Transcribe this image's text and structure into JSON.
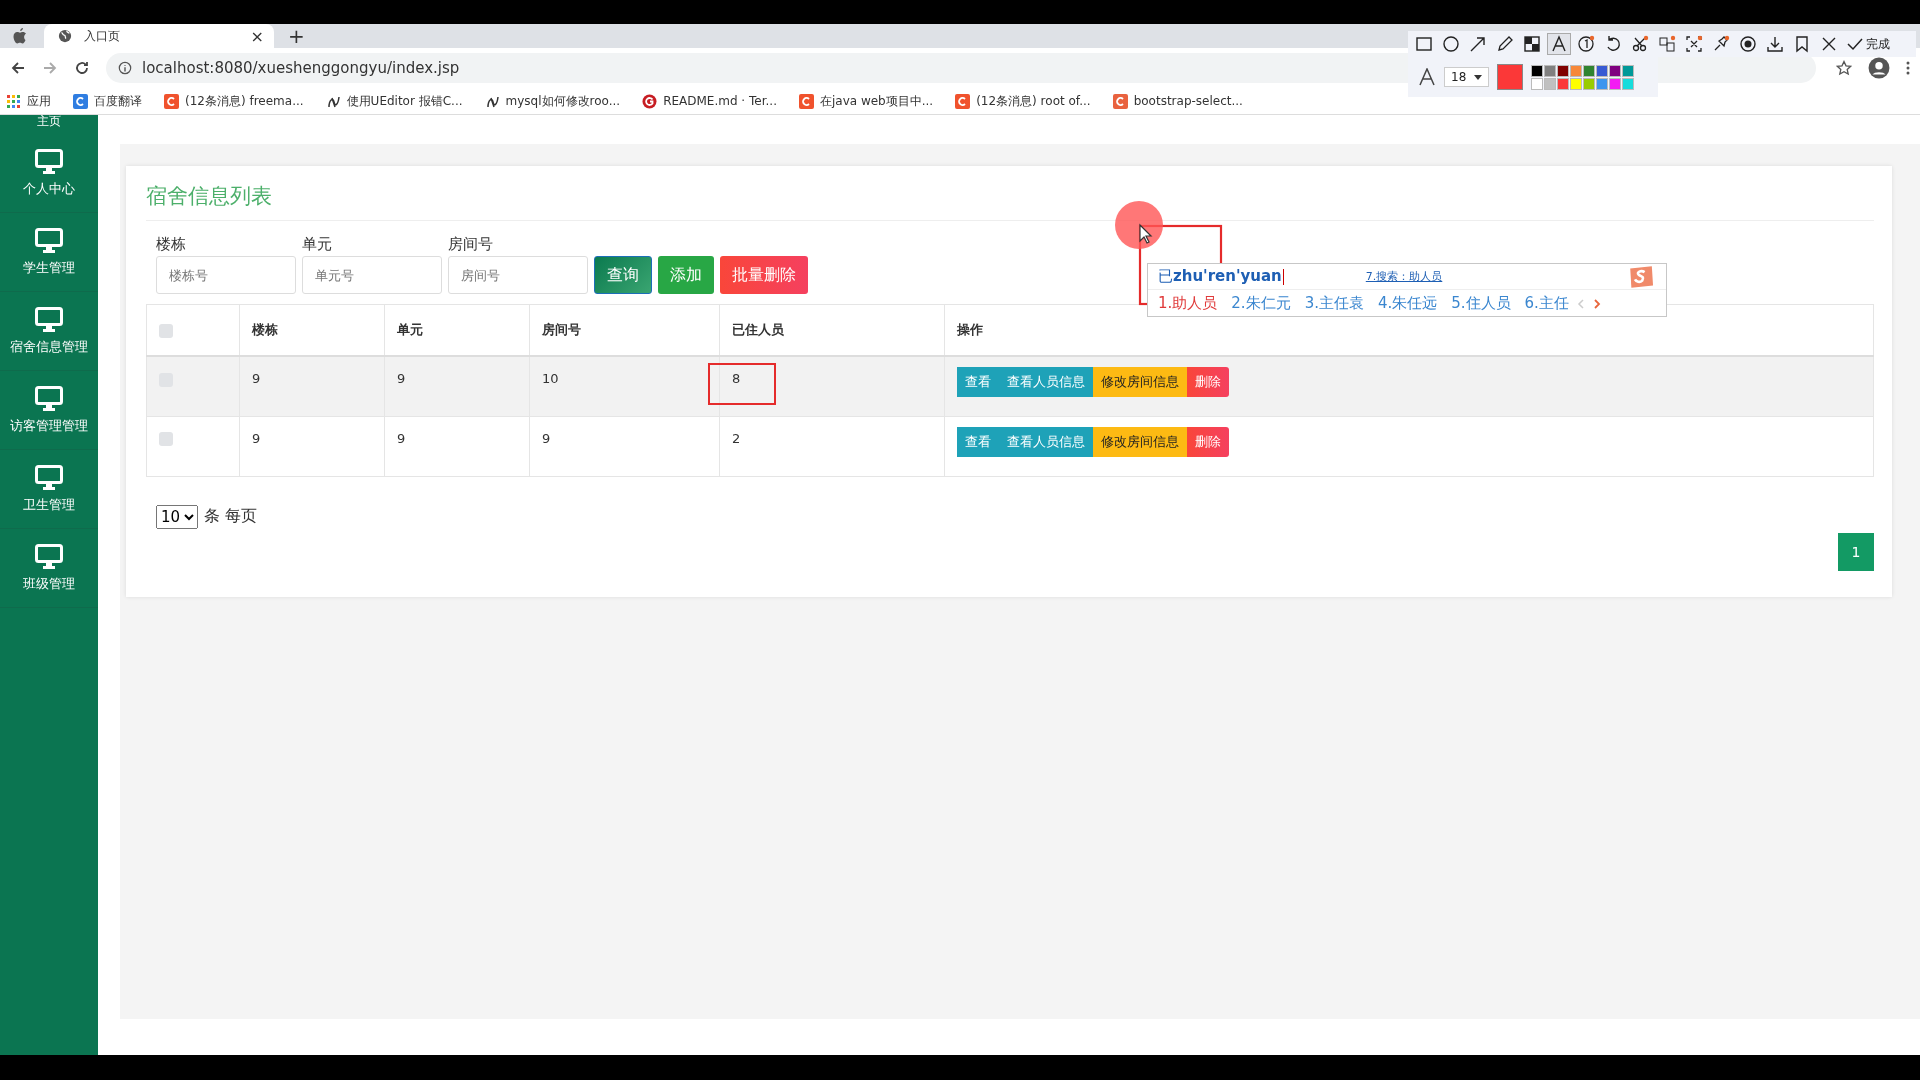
{
  "browser": {
    "tabs": [
      {
        "title": "入口页",
        "selected": true
      }
    ],
    "close_tab": "×",
    "new_tab": "+",
    "url": "localhost:8080/xueshenggongyu/index.jsp",
    "bookmarks": [
      {
        "label": "应用",
        "kind": "apps"
      },
      {
        "label": "百度翻译",
        "kind": "translate"
      },
      {
        "label": "(12条消息) freema...",
        "kind": "csdn"
      },
      {
        "label": "使用UEditor 报错C...",
        "kind": "swirl"
      },
      {
        "label": "mysql如何修改roo...",
        "kind": "swirl"
      },
      {
        "label": "README.md · Ter...",
        "kind": "gitee"
      },
      {
        "label": "在java web项目中...",
        "kind": "csdn"
      },
      {
        "label": "(12条消息) root of...",
        "kind": "csdn"
      },
      {
        "label": "bootstrap-select...",
        "kind": "jianshu"
      }
    ]
  },
  "annotation_toolbar": {
    "tools": [
      {
        "kind": "rectangle",
        "selected": false
      },
      {
        "kind": "ellipse",
        "selected": false
      },
      {
        "kind": "arrow",
        "selected": false
      },
      {
        "kind": "pencil",
        "selected": false
      },
      {
        "kind": "mosaic",
        "selected": false
      },
      {
        "kind": "text",
        "selected": true
      },
      {
        "kind": "number",
        "selected": false
      },
      {
        "kind": "undo",
        "selected": false
      },
      {
        "kind": "cut",
        "selected": false
      },
      {
        "kind": "ocr",
        "selected": false
      },
      {
        "kind": "translate",
        "selected": false
      },
      {
        "kind": "pin",
        "selected": false
      },
      {
        "kind": "record",
        "selected": false
      },
      {
        "kind": "download",
        "selected": false
      },
      {
        "kind": "bookmark",
        "selected": false
      },
      {
        "kind": "close",
        "selected": false
      }
    ],
    "done": "完成",
    "font_size": "18",
    "current": {
      "color": "#fb3838"
    },
    "palette": [
      {
        "color": "#000000"
      },
      {
        "color": "#808080"
      },
      {
        "color": "#800000"
      },
      {
        "color": "#f7883a"
      },
      {
        "color": "#308430"
      },
      {
        "color": "#385ad3"
      },
      {
        "color": "#800080"
      },
      {
        "color": "#009999"
      },
      {
        "color": "#ffffff"
      },
      {
        "color": "#c0c0c0"
      },
      {
        "color": "#fb3838"
      },
      {
        "color": "#ffff00"
      },
      {
        "color": "#99cc00"
      },
      {
        "color": "#3d95ee"
      },
      {
        "color": "#f31bf3"
      },
      {
        "color": "#16dcdc"
      }
    ]
  },
  "sidebar": {
    "items": [
      {
        "label": "主页"
      },
      {
        "label": "个人中心"
      },
      {
        "label": "学生管理"
      },
      {
        "label": "宿舍信息管理"
      },
      {
        "label": "访客管理管理"
      },
      {
        "label": "卫生管理"
      },
      {
        "label": "班级管理"
      }
    ]
  },
  "page": {
    "title": "宿舍信息列表",
    "filters": [
      {
        "label": "楼栋",
        "placeholder": "楼栋号"
      },
      {
        "label": "单元",
        "placeholder": "单元号"
      },
      {
        "label": "房间号",
        "placeholder": "房间号"
      }
    ],
    "buttons": [
      {
        "label": "查询",
        "kind": "query"
      },
      {
        "label": "添加",
        "kind": "add"
      },
      {
        "label": "批量删除",
        "kind": "delete"
      }
    ],
    "table": {
      "select_all": false,
      "columns": [
        "楼栋",
        "单元",
        "房间号",
        "已住人员",
        "操作"
      ],
      "rows": [
        {
          "checked": false,
          "hovered": true,
          "cells": [
            "9",
            "9",
            "10",
            "8"
          ],
          "marked": true,
          "actions": [
            {
              "label": "查看",
              "kind": "view"
            },
            {
              "label": "查看人员信息",
              "kind": "view"
            },
            {
              "label": "修改房间信息",
              "kind": "edit"
            },
            {
              "label": "删除",
              "kind": "delete"
            }
          ]
        },
        {
          "checked": false,
          "hovered": false,
          "cells": [
            "9",
            "9",
            "9",
            "2"
          ],
          "marked": false,
          "actions": [
            {
              "label": "查看",
              "kind": "view"
            },
            {
              "label": "查看人员信息",
              "kind": "view"
            },
            {
              "label": "修改房间信息",
              "kind": "edit"
            },
            {
              "label": "删除",
              "kind": "delete"
            }
          ]
        }
      ]
    },
    "page_size": {
      "value": "10",
      "unit": "条 每页"
    },
    "pagination": [
      {
        "label": "1",
        "selected": true
      }
    ]
  },
  "ime": {
    "prefix": "已",
    "pinyin": "zhu'ren'yuan",
    "search": "7.搜索：助人员",
    "candidates": [
      {
        "label": "1.助人员",
        "selected": true
      },
      {
        "label": "2.朱仁元",
        "selected": false
      },
      {
        "label": "3.主任袁",
        "selected": false
      },
      {
        "label": "4.朱任远",
        "selected": false
      },
      {
        "label": "5.住人员",
        "selected": false
      },
      {
        "label": "6.主任",
        "selected": false
      }
    ]
  }
}
